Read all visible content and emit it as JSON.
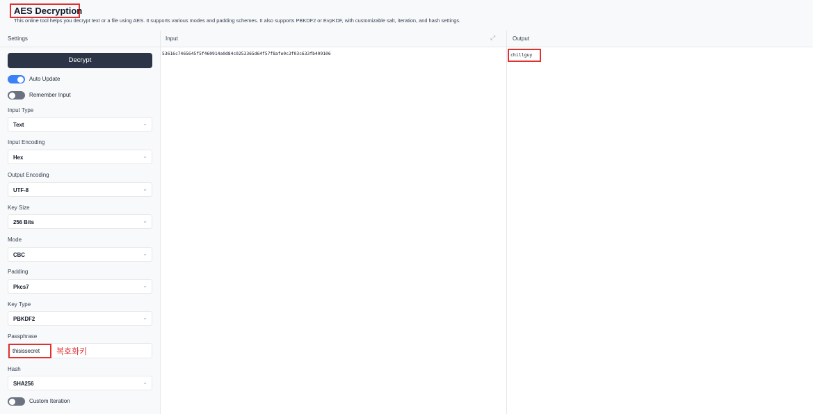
{
  "header": {
    "title": "AES Decryption",
    "subtitle": "This online tool helps you decrypt text or a file using AES. It supports various modes and padding schemes. It also supports PBKDF2 or EvpKDF, with customizable salt, iteration, and hash settings."
  },
  "columns": {
    "settings": "Settings",
    "input": "Input",
    "output": "Output"
  },
  "settings": {
    "decrypt_label": "Decrypt",
    "auto_update": {
      "label": "Auto Update",
      "on": true
    },
    "remember_input": {
      "label": "Remember Input",
      "on": false
    },
    "fields": [
      {
        "label": "Input Type",
        "value": "Text"
      },
      {
        "label": "Input Encoding",
        "value": "Hex"
      },
      {
        "label": "Output Encoding",
        "value": "UTF-8"
      },
      {
        "label": "Key Size",
        "value": "256 Bits"
      },
      {
        "label": "Mode",
        "value": "CBC"
      },
      {
        "label": "Padding",
        "value": "Pkcs7"
      },
      {
        "label": "Key Type",
        "value": "PBKDF2"
      }
    ],
    "passphrase": {
      "label": "Passphrase",
      "value": "thisissecret",
      "annotation": "복호화키"
    },
    "hash": {
      "label": "Hash",
      "value": "SHA256"
    },
    "custom_iteration": {
      "label": "Custom Iteration",
      "on": false
    }
  },
  "input": {
    "value": "53616c7465645f5f460914a0d84c0253365d64f57f8afe0c3f03c633fb409106"
  },
  "output": {
    "value": "chillguy"
  },
  "colors": {
    "accent": "#3b82f6",
    "button": "#2b3547",
    "annotation": "#e03131"
  }
}
